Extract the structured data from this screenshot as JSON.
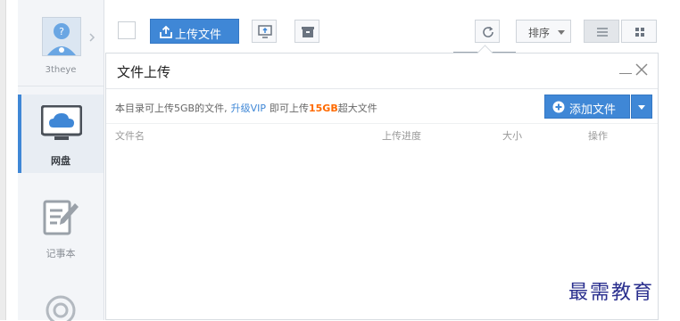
{
  "sidebar": {
    "username": "3theye",
    "items": [
      {
        "label": "网盘",
        "icon": "cloud-monitor-icon",
        "active": true
      },
      {
        "label": "记事本",
        "icon": "notepad-icon",
        "active": false
      },
      {
        "label": "",
        "icon": "circle-icon",
        "active": false
      }
    ]
  },
  "toolbar": {
    "upload_label": "上传文件",
    "sort_label": "排序"
  },
  "panel": {
    "title": "文件上传",
    "info_prefix": "本目录可上传5GB的文件,",
    "info_link": "升级VIP",
    "info_middle": "即可上传",
    "info_highlight": "15GB",
    "info_suffix": "超大文件",
    "add_label": "添加文件",
    "columns": [
      "文件名",
      "上传进度",
      "大小",
      "操作"
    ]
  },
  "watermark": "最需教育",
  "colors": {
    "accent": "#3f87d6",
    "highlight": "#ff6a00",
    "watermark": "#2a2f8e"
  }
}
